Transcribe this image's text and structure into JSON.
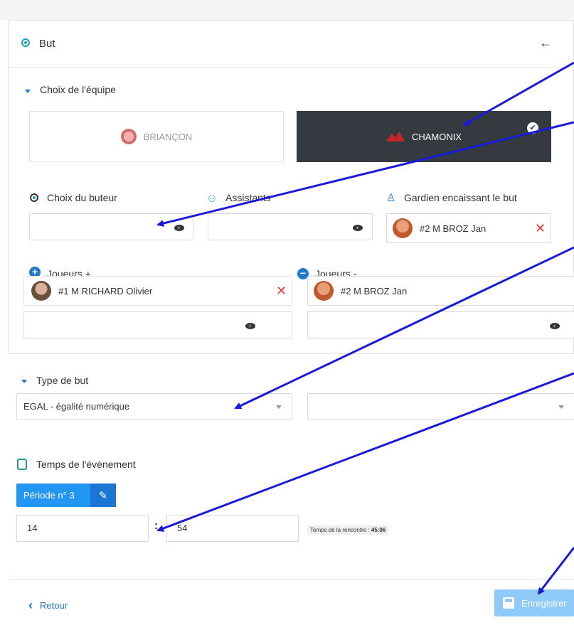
{
  "header": {
    "title": "But",
    "back_arrow": "←"
  },
  "team_section": {
    "label": "Choix de l'équipe",
    "teams": [
      {
        "name": "BRIANÇON",
        "selected": false
      },
      {
        "name": "CHAMONIX",
        "selected": true
      }
    ],
    "check_glyph": "✔"
  },
  "scorer": {
    "label": "Choix du buteur",
    "value": ""
  },
  "assists": {
    "label": "Assistants",
    "value": ""
  },
  "goalie": {
    "label": "Gardien encaissant le but",
    "player": "#2 M BROZ Jan",
    "remove": "✕"
  },
  "players_plus": {
    "label": "Joueurs +",
    "player": "#1 M RICHARD Olivier",
    "remove": "✕"
  },
  "players_minus": {
    "label": "Joueurs -",
    "player": "#2 M BROZ Jan"
  },
  "goal_type": {
    "label": "Type de but",
    "selected": "EGAL - égalité numérique",
    "secondary": ""
  },
  "event_time": {
    "label": "Temps de l'évènement",
    "period_button": "Période n° 3",
    "pencil": "✎",
    "minutes": "14",
    "separator": ":",
    "seconds": "54",
    "match_time_label": "Temps de la rencontre : ",
    "match_time_value": "45:06"
  },
  "footer": {
    "back_label": "Retour",
    "back_glyph": "‹",
    "save_label": "Enregistrer"
  },
  "colors": {
    "accent": "#1f78c8",
    "teal": "#17a2b8",
    "dark": "#343a40",
    "danger": "#e53935",
    "annotation": "#1a1adb"
  }
}
